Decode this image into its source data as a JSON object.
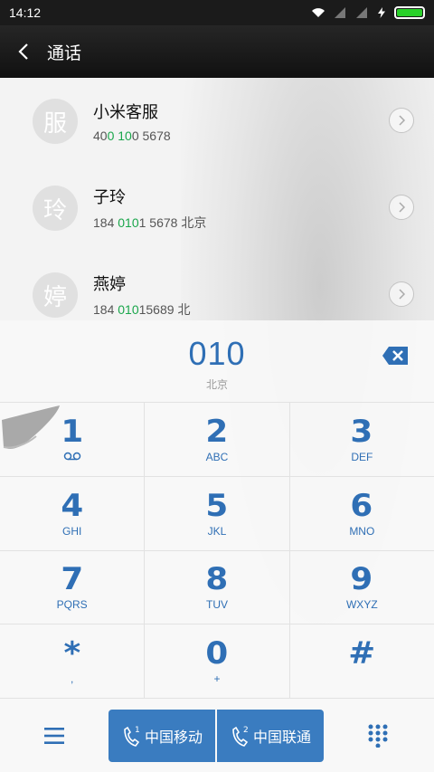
{
  "status_bar": {
    "time": "14:12"
  },
  "header": {
    "title": "通话"
  },
  "contacts": [
    {
      "avatar": "服",
      "name": "小米客服",
      "num_pre": "40",
      "num_hl": "0 10",
      "num_post": "0 5678",
      "location": ""
    },
    {
      "avatar": "玲",
      "name": "子玲",
      "num_pre": "184 ",
      "num_hl": "010",
      "num_post": "1 5678",
      "location": "北京"
    },
    {
      "avatar": "婷",
      "name": "燕婷",
      "num_pre": "184 ",
      "num_hl": "010",
      "num_post": "15689",
      "location": "北"
    }
  ],
  "display": {
    "number": "010",
    "location": "北京"
  },
  "keys": [
    [
      {
        "digit": "1",
        "letters": ""
      },
      {
        "digit": "2",
        "letters": "ABC"
      },
      {
        "digit": "3",
        "letters": "DEF"
      }
    ],
    [
      {
        "digit": "4",
        "letters": "GHI"
      },
      {
        "digit": "5",
        "letters": "JKL"
      },
      {
        "digit": "6",
        "letters": "MNO"
      }
    ],
    [
      {
        "digit": "7",
        "letters": "PQRS"
      },
      {
        "digit": "8",
        "letters": "TUV"
      },
      {
        "digit": "9",
        "letters": "WXYZ"
      }
    ],
    [
      {
        "digit": "*",
        "letters": ","
      },
      {
        "digit": "0",
        "letters": "+"
      },
      {
        "digit": "#",
        "letters": ""
      }
    ]
  ],
  "call_buttons": [
    {
      "sim": "1",
      "label": "中国移动"
    },
    {
      "sim": "2",
      "label": "中国联通"
    }
  ],
  "colors": {
    "accent": "#2f6fb5",
    "call_button": "#3a7cc0",
    "highlight": "#1aa64b",
    "battery": "#2ad12a"
  },
  "icons": {
    "back": "back-arrow-icon",
    "delete": "backspace-icon",
    "voicemail": "voicemail-icon",
    "menu": "menu-icon",
    "dialpad": "dialpad-icon",
    "phone": "phone-icon"
  }
}
